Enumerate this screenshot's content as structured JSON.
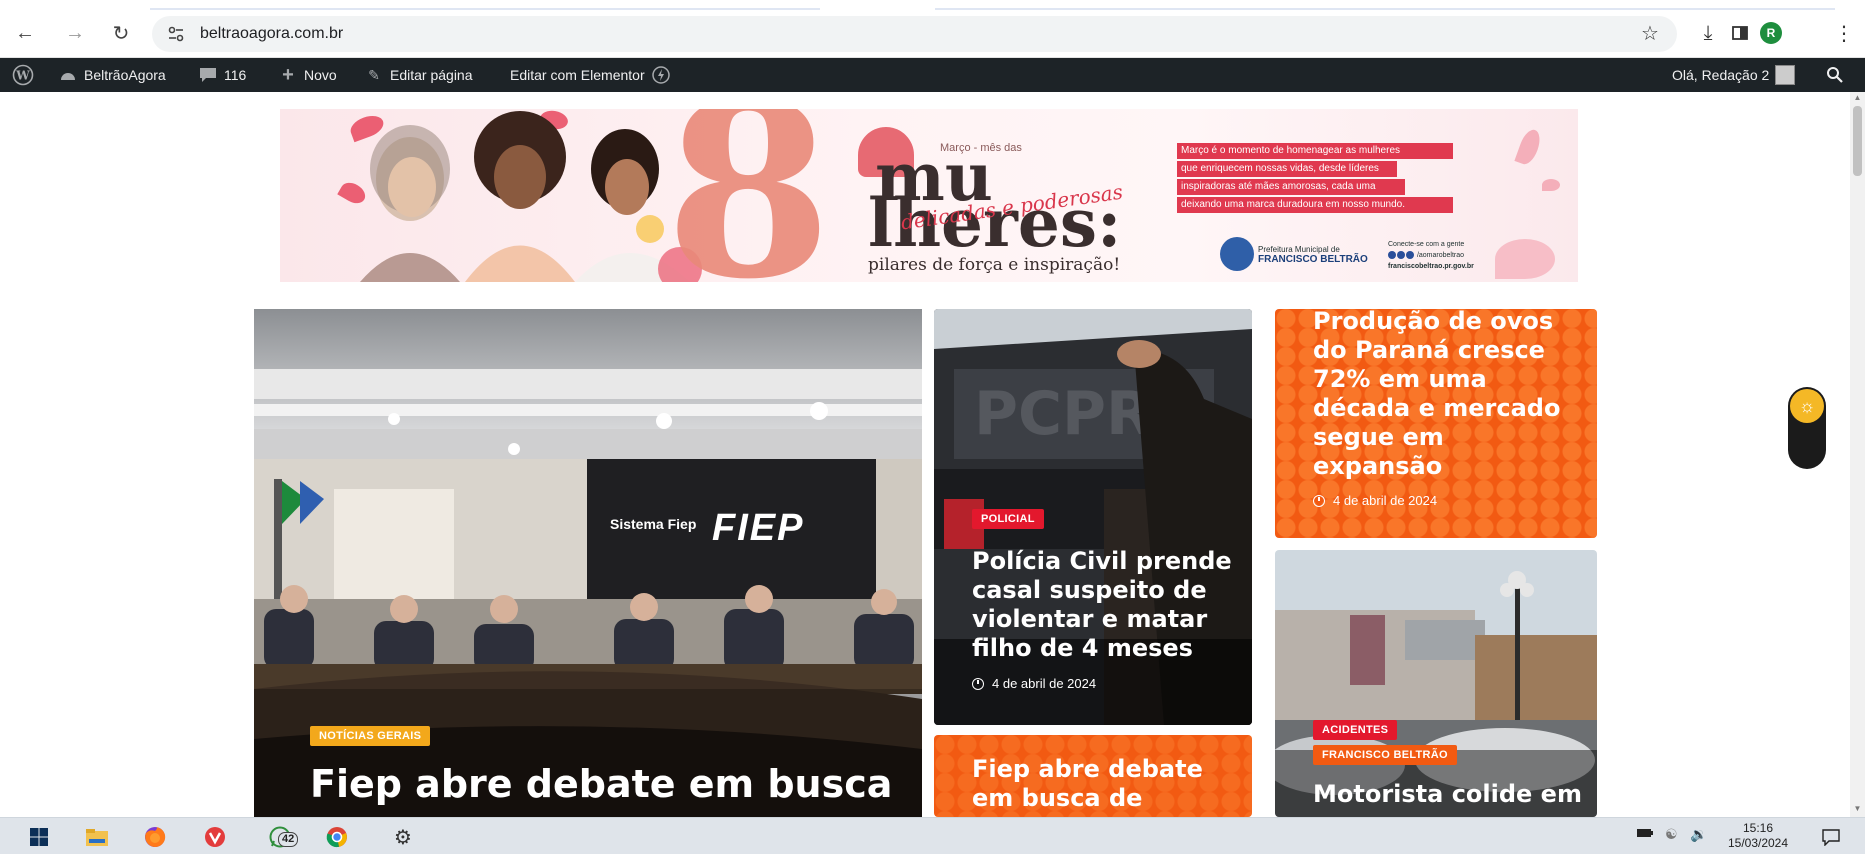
{
  "browser": {
    "url": "beltraoagora.com.br",
    "profile_initial": "R"
  },
  "adminbar": {
    "site_name": "BeltrãoAgora",
    "comments_count": "116",
    "new_label": "Novo",
    "edit_page_label": "Editar página",
    "elementor_label": "Editar com Elementor",
    "greeting": "Olá, Redação 2"
  },
  "banner": {
    "big_number": "8",
    "month_text": "Março - mês das",
    "title_part1": "mu",
    "title_part2": "lheres:",
    "script_text": "delicadas e poderosas",
    "tagline": "pilares de força e inspiração!",
    "lines": [
      "Março é o momento de homenagear as mulheres",
      "que enriquecem nossas vidas, desde líderes",
      "inspiradoras até mães amorosas, cada uma",
      "deixando uma marca duradoura em nosso mundo."
    ],
    "pref_small": "Prefeitura Municipal de",
    "pref_name": "FRANCISCO BELTRÃO",
    "connect": "Conecte-se com a gente",
    "handle": "/aomarobeltrao",
    "site": "franciscobeltrao.pr.gov.br"
  },
  "articles": {
    "main": {
      "category": "NOTÍCIAS GERAIS",
      "title": "Fiep abre debate em busca",
      "sign_text": "Sistema Fiep",
      "sign_brand": "FIEP"
    },
    "police": {
      "category": "POLICIAL",
      "title": "Polícia Civil prende casal suspeito de violentar e matar filho de 4 meses",
      "date": "4 de abril de 2024"
    },
    "ovos": {
      "title": "Produção de ovos do Paraná cresce 72% em uma década e mercado segue em expansão",
      "date": "4 de abril de 2024"
    },
    "fiep_small": {
      "title": "Fiep abre debate em busca de"
    },
    "acidente": {
      "category1": "ACIDENTES",
      "category2": "FRANCISCO BELTRÃO",
      "title": "Motorista colide em"
    }
  },
  "taskbar": {
    "whatsapp_badge": "42",
    "time": "15:16",
    "date": "15/03/2024"
  },
  "colors": {
    "accent_orange": "#f25a12",
    "tag_yellow": "#f3a81b",
    "tag_red": "#e3182d",
    "admin_bar": "#1d2327"
  }
}
